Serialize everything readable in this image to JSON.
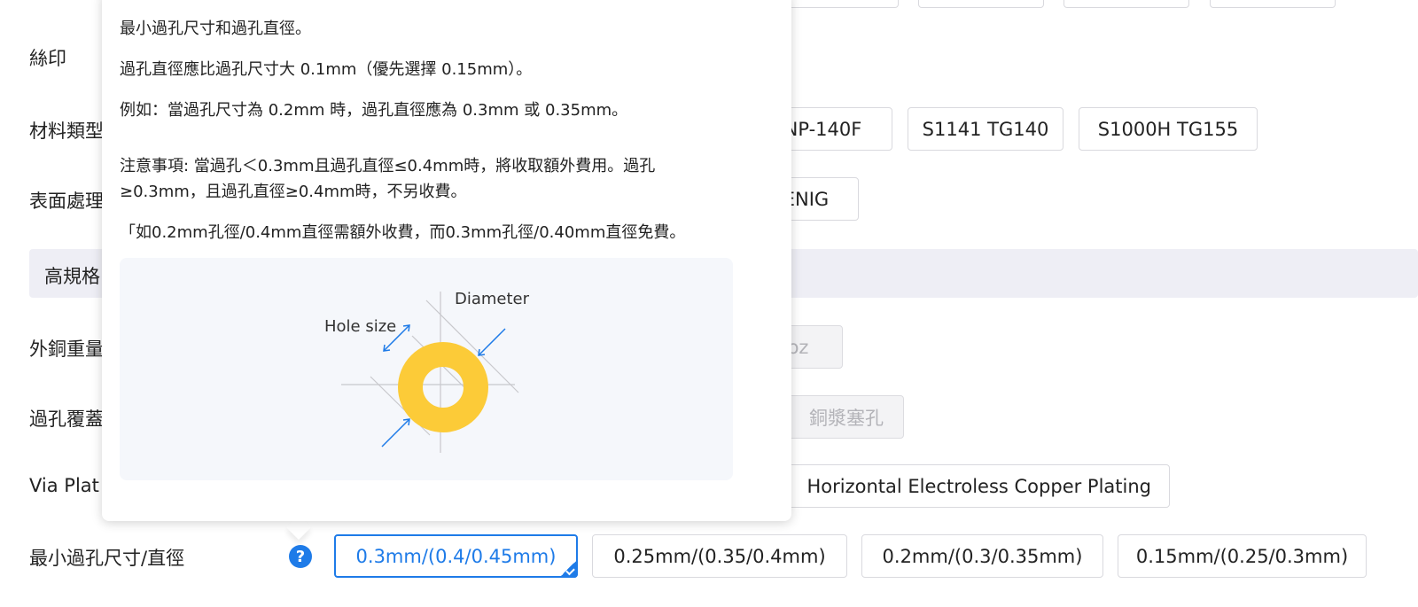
{
  "top_options": [
    "",
    "",
    "",
    ""
  ],
  "labels": {
    "silkscreen": "絲印",
    "material_type": "材料類型",
    "surface_finish": "表面處理",
    "advanced_section": "高規格",
    "outer_copper": "外銅重量",
    "via_covering": "過孔覆蓋",
    "via_plating": "Via Plat",
    "min_via": "最小過孔尺寸/直徑"
  },
  "material_options": [
    "NP-140F",
    "S1141 TG140",
    "S1000H TG155"
  ],
  "surface_options": [
    "ENIG"
  ],
  "copper_options": [
    "oz"
  ],
  "via_cover_options": [
    "銅漿塞孔"
  ],
  "via_plating_options": [
    "Horizontal Electroless Copper Plating"
  ],
  "min_via_options": [
    "0.3mm/(0.4/0.45mm)",
    "0.25mm/(0.35/0.4mm)",
    "0.2mm/(0.3/0.35mm)",
    "0.15mm/(0.25/0.3mm)"
  ],
  "help_icon": "?",
  "tooltip": {
    "line1": "最小過孔尺寸和過孔直徑。",
    "line2": "過孔直徑應比過孔尺寸大 0.1mm（優先選擇 0.15mm）。",
    "line3": "例如：當過孔尺寸為 0.2mm 時，過孔直徑應為 0.3mm 或 0.35mm。",
    "note1": "注意事項: 當過孔＜0.3mm且過孔直徑≤0.4mm時，將收取額外費用。過孔",
    "note2": "≥0.3mm，且過孔直徑≥0.4mm時，不另收費。",
    "example": "「如0.2mm孔徑/0.4mm直徑需額外收費，而0.3mm孔徑/0.40mm直徑免費。",
    "diagram_diameter": "Diameter",
    "diagram_hole_size": "Hole size"
  },
  "colors": {
    "accent": "#1e7be8",
    "pad": "#fccb38"
  }
}
